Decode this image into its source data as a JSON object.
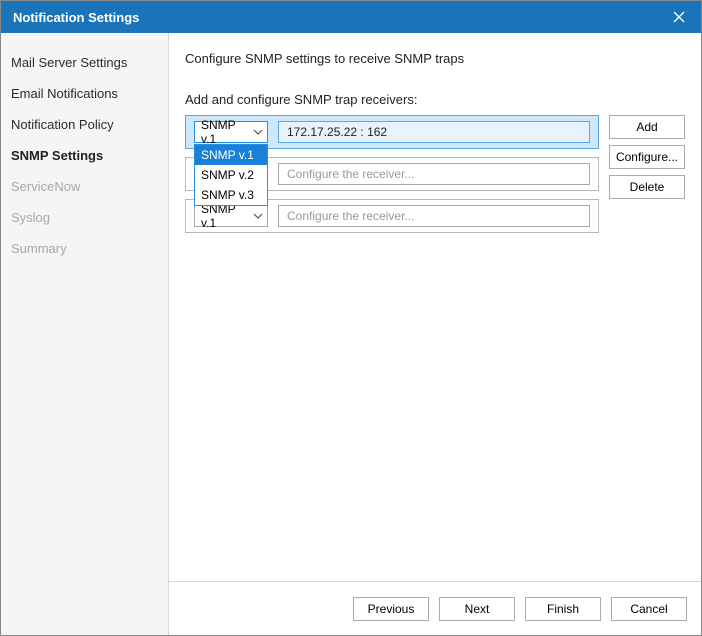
{
  "title": "Notification Settings",
  "sidebar": {
    "items": [
      {
        "label": "Mail Server Settings",
        "state": "normal"
      },
      {
        "label": "Email Notifications",
        "state": "normal"
      },
      {
        "label": "Notification Policy",
        "state": "normal"
      },
      {
        "label": "SNMP Settings",
        "state": "selected"
      },
      {
        "label": "ServiceNow",
        "state": "disabled"
      },
      {
        "label": "Syslog",
        "state": "disabled"
      },
      {
        "label": "Summary",
        "state": "disabled"
      }
    ]
  },
  "main": {
    "header": "Configure SNMP settings to receive SNMP traps",
    "section_label": "Add and configure SNMP trap receivers:",
    "rows": [
      {
        "version": "SNMP v.1",
        "value": "172.17.25.22 : 162",
        "placeholder": "",
        "selected": true,
        "dropdown_open": true
      },
      {
        "version": "SNMP v.1",
        "value": "",
        "placeholder": "Configure the receiver...",
        "selected": false,
        "dropdown_open": false
      },
      {
        "version": "SNMP v.1",
        "value": "",
        "placeholder": "Configure the receiver...",
        "selected": false,
        "dropdown_open": false
      }
    ],
    "dropdown_options": [
      "SNMP v.1",
      "SNMP v.2",
      "SNMP v.3"
    ],
    "dropdown_highlight": 0,
    "buttons": {
      "add": "Add",
      "configure": "Configure...",
      "delete": "Delete"
    }
  },
  "footer": {
    "previous": "Previous",
    "next": "Next",
    "finish": "Finish",
    "cancel": "Cancel"
  }
}
